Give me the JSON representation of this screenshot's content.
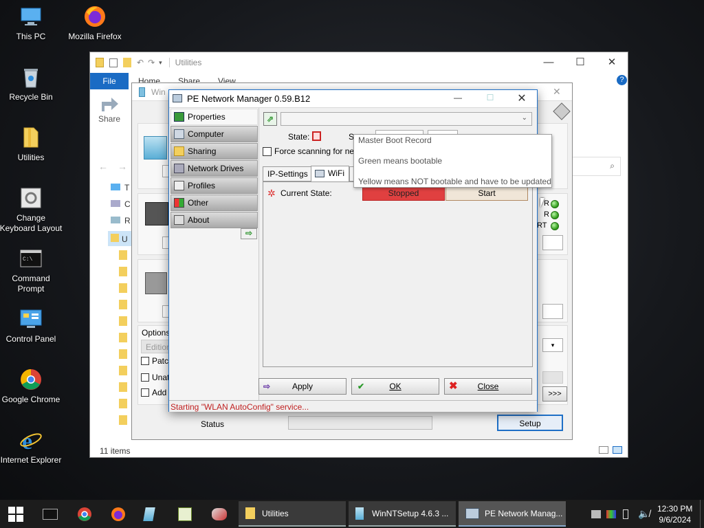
{
  "desktop": {
    "icons": [
      {
        "label": "This PC",
        "icon": "this-pc-icon"
      },
      {
        "label": "Mozilla Firefox",
        "icon": "firefox-icon"
      },
      {
        "label": "Recycle Bin",
        "icon": "recycle-bin-icon"
      },
      {
        "label": "Utilities",
        "icon": "folder-icon"
      },
      {
        "label": "Change Keyboard Layout",
        "icon": "keyboard-settings-icon"
      },
      {
        "label": "Command Prompt",
        "icon": "command-prompt-icon"
      },
      {
        "label": "Control Panel",
        "icon": "control-panel-icon"
      },
      {
        "label": "Google Chrome",
        "icon": "chrome-icon"
      },
      {
        "label": "Internet Explorer",
        "icon": "ie-icon"
      }
    ]
  },
  "explorer": {
    "title": "Utilities",
    "tabs": [
      "File",
      "Home",
      "Share",
      "View"
    ],
    "ribbon_share_label": "Share",
    "nav_letters": [
      "T",
      "C",
      "R",
      "U"
    ],
    "status_items": "11 items",
    "colors": {
      "file_tab": "#1a6bc4"
    }
  },
  "winntsetup": {
    "title": "Win",
    "options_label": "Options",
    "edition_placeholder": "Edition",
    "checkboxes": [
      "Patch",
      "Unat",
      "Add"
    ],
    "status_label": "Status",
    "setup_button": "Setup",
    "more_button": ">>>",
    "indicator_labels": [
      "R",
      "R",
      "RT"
    ]
  },
  "pe": {
    "title": "PE Network Manager 0.59.B12",
    "sidebar": [
      "Properties",
      "Computer",
      "Sharing",
      "Network Drives",
      "Profiles",
      "Other",
      "About"
    ],
    "state_label": "State:",
    "state_partial": "S",
    "force_scanning": "Force scanning for nev",
    "tabs": [
      "IP-Settings",
      "WiFi"
    ],
    "current_state_label": "Current State:",
    "state_value": "Stopped",
    "start_button": "Start",
    "apply_button": "Apply",
    "ok_button": "OK",
    "close_button": "Close",
    "status_message": "Starting \"WLAN AutoConfig\" service...",
    "colors": {
      "stopped": "#e04040",
      "status_text": "#c02020",
      "title_accent": "#1e6fc6"
    }
  },
  "tooltip": {
    "lines": [
      "Master Boot Record",
      "Green means bootable",
      "Yellow means NOT bootable and have to be updated"
    ]
  },
  "taskbar": {
    "tasks": [
      {
        "label": "Utilities"
      },
      {
        "label": "WinNTSetup 4.6.3 ..."
      },
      {
        "label": "PE Network Manag..."
      }
    ],
    "time": "12:30 PM",
    "date": "9/6/2024"
  }
}
